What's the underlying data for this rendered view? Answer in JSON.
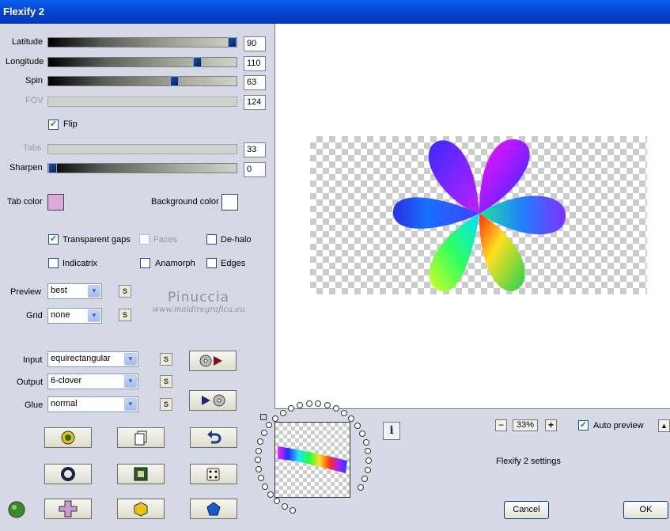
{
  "window": {
    "title": "Flexify 2"
  },
  "sliders": [
    {
      "label": "Latitude",
      "value": "90",
      "level": 0.98,
      "enabled": true
    },
    {
      "label": "Longitude",
      "value": "110",
      "level": 0.79,
      "enabled": true
    },
    {
      "label": "Spin",
      "value": "63",
      "level": 0.67,
      "enabled": true
    },
    {
      "label": "FOV",
      "value": "124",
      "enabled": false
    },
    {
      "label": "Tabs",
      "value": "33",
      "enabled": false
    },
    {
      "label": "Sharpen",
      "value": "0",
      "level": 0.0,
      "enabled": true
    }
  ],
  "flip": {
    "label": "Flip",
    "checked": true
  },
  "tab_color": {
    "label": "Tab color",
    "color": "#dcaad8"
  },
  "background_color": {
    "label": "Background color",
    "color": "#ffffff"
  },
  "options": {
    "transparent_gaps": {
      "label": "Transparent gaps",
      "checked": true
    },
    "faces": {
      "label": "Faces",
      "checked": false,
      "enabled": false
    },
    "de_halo": {
      "label": "De-halo",
      "checked": false
    },
    "indicatrix": {
      "label": "Indicatrix",
      "checked": false
    },
    "anamorph": {
      "label": "Anamorph",
      "checked": false
    },
    "edges": {
      "label": "Edges",
      "checked": false
    }
  },
  "preview_select": {
    "label": "Preview",
    "value": "best"
  },
  "grid_select": {
    "label": "Grid",
    "value": "none"
  },
  "input_select": {
    "label": "Input",
    "value": "equirectangular"
  },
  "output_select": {
    "label": "Output",
    "value": "6-clover"
  },
  "glue_select": {
    "label": "Glue",
    "value": "normal"
  },
  "s_button_label": "S",
  "watermark": {
    "line1": "Pinuccia",
    "line2": "www.maidiregrafica.eu"
  },
  "zoom": {
    "value": "33%",
    "minus": "−",
    "plus": "+"
  },
  "auto_preview": {
    "label": "Auto preview",
    "checked": true
  },
  "settings_label": "Flexify 2 settings",
  "buttons": {
    "cancel": "Cancel",
    "ok": "OK"
  },
  "info_icon": "i",
  "colors": {
    "title_bar": "#0a4fd6",
    "panel": "#d6d8e5",
    "accent_check": "#1c8a1c"
  }
}
